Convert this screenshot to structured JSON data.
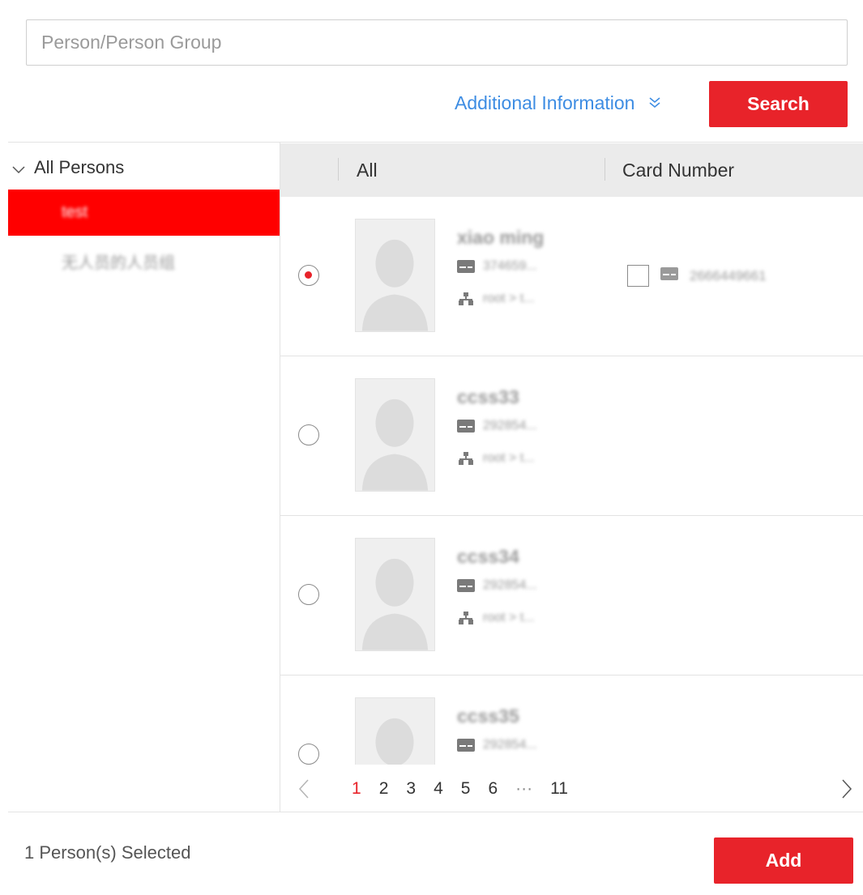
{
  "search": {
    "placeholder": "Person/Person Group",
    "value": ""
  },
  "additional_info": {
    "label": "Additional Information",
    "icon": "double-chevron-down-icon"
  },
  "search_button": {
    "label": "Search"
  },
  "tree": {
    "root": {
      "label": "All Persons",
      "expanded": true
    },
    "items": [
      {
        "label": "test",
        "selected": true
      },
      {
        "label": "无人员的人员组",
        "selected": false
      }
    ]
  },
  "table": {
    "columns": [
      {
        "label": "All"
      },
      {
        "label": "Card Number"
      }
    ],
    "rows": [
      {
        "name": "xiao ming",
        "id": "374659...",
        "org": "root > t...",
        "selected": true,
        "card_number": "2666449661",
        "has_card": true
      },
      {
        "name": "ccss33",
        "id": "292854...",
        "org": "root > t...",
        "selected": false,
        "card_number": "",
        "has_card": false
      },
      {
        "name": "ccss34",
        "id": "292854...",
        "org": "root > t...",
        "selected": false,
        "card_number": "",
        "has_card": false
      },
      {
        "name": "ccss35",
        "id": "292854...",
        "org": "",
        "selected": false,
        "card_number": "",
        "has_card": false
      }
    ]
  },
  "pagination": {
    "pages": [
      "1",
      "2",
      "3",
      "4",
      "5",
      "6",
      "···",
      "11"
    ],
    "current": "1"
  },
  "footer": {
    "selected_text": "1 Person(s) Selected",
    "add_label": "Add"
  },
  "colors": {
    "accent_red": "#e8232a",
    "tree_selected_bg": "#ff0000",
    "link_blue": "#3e8de3",
    "header_bg": "#ebebeb"
  }
}
